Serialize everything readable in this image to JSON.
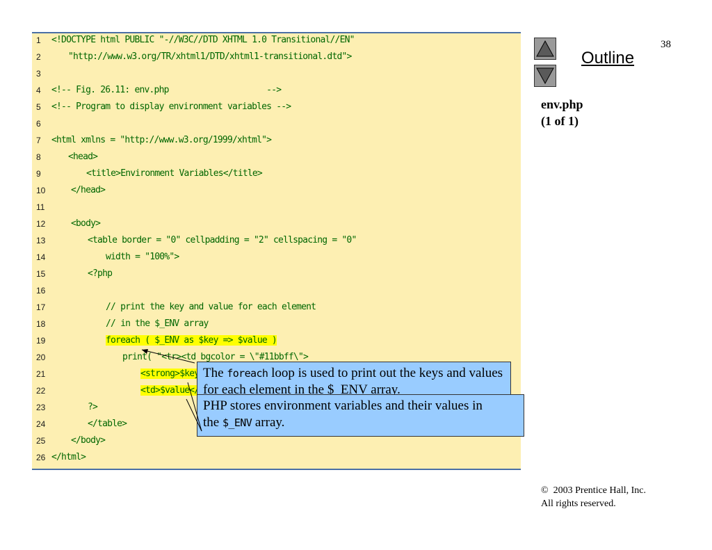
{
  "slide": {
    "page_number": "38",
    "outline_label": "Outline",
    "file_name": "env.php",
    "file_pages": "(1 of 1)",
    "copyright_symbol": "©",
    "copyright_line1": "2003 Prentice Hall, Inc.",
    "copyright_line2": "All rights reserved."
  },
  "code_lines": [
    {
      "n": "1",
      "text": "<!DOCTYPE html PUBLIC \"-//W3C//DTD XHTML 1.0 Transitional//EN\""
    },
    {
      "n": "2",
      "text": "\"http://www.w3.org/TR/xhtml1/DTD/xhtml1-transitional.dtd\">"
    },
    {
      "n": "3",
      "text": ""
    },
    {
      "n": "4",
      "text": "<!-- Fig. 26.11: env.php                    -->"
    },
    {
      "n": "5",
      "text": "<!-- Program to display environment variables -->"
    },
    {
      "n": "6",
      "text": ""
    },
    {
      "n": "7",
      "text": "<html xmlns = \"http://www.w3.org/1999/xhtml\">"
    },
    {
      "n": "8",
      "text": "<head>"
    },
    {
      "n": "9a",
      "text": "<title>"
    },
    {
      "n": "9b",
      "text": "Environment Variables"
    },
    {
      "n": "9c",
      "text": "</title>"
    },
    {
      "n": "10",
      "text": "</head>"
    },
    {
      "n": "11",
      "text": ""
    },
    {
      "n": "12",
      "text": "<body>"
    },
    {
      "n": "13",
      "text": "<table border = \"0\" cellpadding = \"2\" cellspacing = \"0\""
    },
    {
      "n": "14",
      "text": "width = \"100%\">"
    },
    {
      "n": "15",
      "text": "<?php"
    },
    {
      "n": "16",
      "text": ""
    },
    {
      "n": "17",
      "text": "// print the key and value for each element"
    },
    {
      "n": "18",
      "text": "// in the $_ENV array"
    },
    {
      "n": "19",
      "text": "foreach ( $_ENV as $key => $value )"
    },
    {
      "n": "20",
      "text": "print( \"<tr><td bgcolor = \\\"#11bbff\\\">"
    },
    {
      "n": "21",
      "text": "<strong>$key</strong></td>"
    },
    {
      "n": "22",
      "text": "<td>$value</td></tr>\" );"
    },
    {
      "n": "23",
      "text": "?>"
    },
    {
      "n": "24",
      "text": "</table>"
    },
    {
      "n": "25",
      "text": "</body>"
    },
    {
      "n": "26",
      "text": "</html>"
    }
  ],
  "callouts": {
    "foreach_pre": "The ",
    "foreach_code": "foreach",
    "foreach_post": " loop is used to print out the keys and values for each element in the $_ENV array.",
    "env_line1": "PHP stores environment variables and their values in",
    "env_pre": "the ",
    "env_code": "$_ENV",
    "env_post": " array."
  },
  "nav": {
    "up_icon": "triangle-up-icon",
    "down_icon": "triangle-down-icon"
  }
}
